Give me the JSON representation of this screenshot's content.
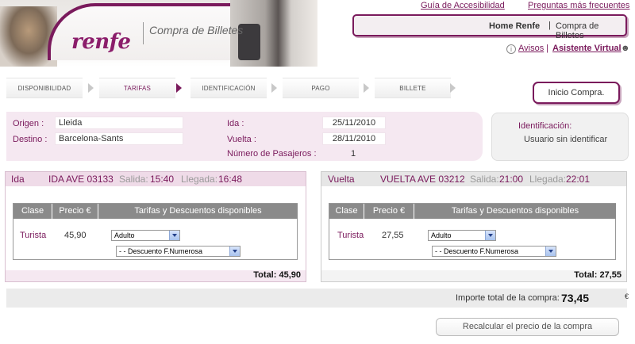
{
  "header": {
    "logo_text": "renfe",
    "banner_title": "Compra de Billetes",
    "links": {
      "accesibilidad": "Guía de Accesibilidad",
      "preguntas": "Preguntas más frecuentes"
    },
    "nav": {
      "home": "Home Renfe",
      "separator": "|",
      "compra": "Compra de Billetes"
    },
    "avisos": "Avisos",
    "asistente": "Asistente Virtual",
    "sep": "|"
  },
  "steps": [
    {
      "label": "DISPONIBILIDAD",
      "active": false
    },
    {
      "label": "TARIFAS",
      "active": true
    },
    {
      "label": "IDENTIFICACIÓN",
      "active": false
    },
    {
      "label": "PAGO",
      "active": false
    },
    {
      "label": "BILLETE",
      "active": false
    }
  ],
  "inicio_button": "Inicio Compra.",
  "trip": {
    "origen_label": "Origen :",
    "origen": "Lleida",
    "destino_label": "Destino :",
    "destino": "Barcelona-Sants",
    "ida_label": "Ida :",
    "ida": "25/11/2010",
    "vuelta_label": "Vuelta :",
    "vuelta": "28/11/2010",
    "pasajeros_label": "Número de Pasajeros :",
    "pasajeros": "1"
  },
  "identificacion": {
    "title": "Identificación:",
    "value": "Usuario sin identificar"
  },
  "table_headers": {
    "clase": "Clase",
    "precio": "Precio €",
    "tarifas": "Tarifas y Descuentos disponibles"
  },
  "ida": {
    "dir": "Ida",
    "tren": "IDA AVE 03133",
    "salida_label": "Salida:",
    "salida": "15:40",
    "llegada_label": "Llegada:",
    "llegada": "16:48",
    "clase": "Turista",
    "precio": "45,90",
    "tarifa": "Adulto",
    "descuento": "- - Descuento F.Numerosa",
    "total": "Total: 45,90"
  },
  "vuelta": {
    "dir": "Vuelta",
    "tren": "VUELTA AVE 03212",
    "salida_label": "Salida:",
    "salida": "21:00",
    "llegada_label": "Llegada:",
    "llegada": "22:01",
    "clase": "Turista",
    "precio": "27,55",
    "tarifa": "Adulto",
    "descuento": "- - Descuento F.Numerosa",
    "total": "Total: 27,55"
  },
  "totals": {
    "label": "Importe total de la compra:",
    "value": "73,45",
    "currency": "€"
  },
  "recalc_button": "Recalcular el precio de la compra",
  "colors": {
    "brand": "#7a1a5c",
    "panel_bg": "#f5e8f1",
    "header_grey": "#8a8a8a"
  }
}
